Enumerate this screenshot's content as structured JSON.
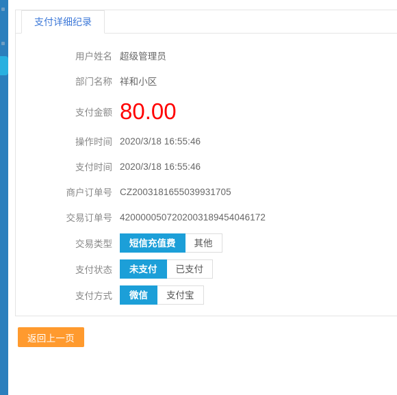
{
  "sidebar": {
    "accent_color": "#2b7fbd",
    "active_color": "#29b0e0",
    "items": [
      {
        "name": "nav-item-1",
        "active": false
      },
      {
        "name": "nav-item-2",
        "active": false
      },
      {
        "name": "nav-item-3",
        "active": true
      }
    ]
  },
  "panel": {
    "tabs": [
      {
        "label": "支付详细纪录",
        "active": true
      }
    ]
  },
  "form": {
    "rows": [
      {
        "label": "用户姓名",
        "value": "超级管理员"
      },
      {
        "label": "部门名称",
        "value": "祥和小区"
      },
      {
        "label": "支付金额",
        "value": "80.00"
      },
      {
        "label": "操作时间",
        "value": "2020/3/18 16:55:46"
      },
      {
        "label": "支付时间",
        "value": "2020/3/18 16:55:46"
      },
      {
        "label": "商户订单号",
        "value": "CZ2003181655039931705"
      },
      {
        "label": "交易订单号",
        "value": "4200000507202003189454046172"
      }
    ],
    "labels": {
      "user_name": "用户姓名",
      "department_name": "部门名称",
      "pay_amount": "支付金额",
      "operate_time": "操作时间",
      "pay_time": "支付时间",
      "merchant_order_no": "商户订单号",
      "transaction_order_no": "交易订单号",
      "transaction_type": "交易类型",
      "pay_status": "支付状态",
      "pay_method": "支付方式"
    },
    "values": {
      "user_name": "超级管理员",
      "department_name": "祥和小区",
      "pay_amount": "80.00",
      "operate_time": "2020/3/18 16:55:46",
      "pay_time": "2020/3/18 16:55:46",
      "merchant_order_no": "CZ2003181655039931705",
      "transaction_order_no": "4200000507202003189454046172"
    },
    "amount_color": "#ff0000",
    "radio_groups": {
      "transaction_type": {
        "label": "交易类型",
        "selected": "短信充值费",
        "options": [
          {
            "label": "短信充值费",
            "selected": true
          },
          {
            "label": "其他",
            "selected": false
          }
        ]
      },
      "pay_status": {
        "label": "支付状态",
        "selected": "未支付",
        "options": [
          {
            "label": "未支付",
            "selected": true
          },
          {
            "label": "已支付",
            "selected": false
          }
        ]
      },
      "pay_method": {
        "label": "支付方式",
        "selected": "微信",
        "options": [
          {
            "label": "微信",
            "selected": true
          },
          {
            "label": "支付宝",
            "selected": false
          }
        ]
      }
    },
    "selected_color": "#1c9fd8"
  },
  "actions": {
    "back_label": "返回上一页",
    "back_color": "#ff9a2e"
  }
}
